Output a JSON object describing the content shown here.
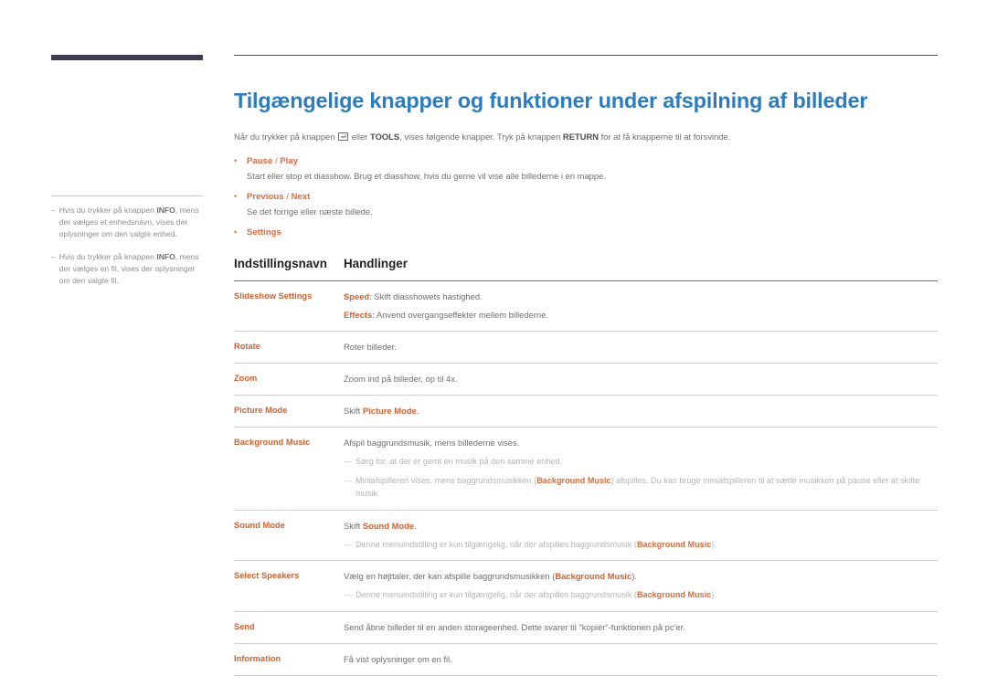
{
  "sidebar": {
    "notes": [
      {
        "marker": "–",
        "segments": [
          {
            "t": "Hvis du trykker på knappen ",
            "b": false
          },
          {
            "t": "INFO",
            "b": true
          },
          {
            "t": ", mens der vælges et enhedsnavn, vises der oplysninger om den valgte enhed.",
            "b": false
          }
        ]
      },
      {
        "marker": "–",
        "segments": [
          {
            "t": "Hvis du trykker på knappen ",
            "b": false
          },
          {
            "t": "INFO",
            "b": true
          },
          {
            "t": ", mens der vælges en fil, vises der oplysninger om den valgte fil.",
            "b": false
          }
        ]
      }
    ]
  },
  "main": {
    "title": "Tilgængelige knapper og funktioner under afspilning af billeder",
    "intro": {
      "part1": "Når du trykker på knappen ",
      "key_icon": "enter-key-icon",
      "part2": " eller ",
      "tools": "TOOLS",
      "part3": ", vises følgende knapper. Tryk på knappen ",
      "return": "RETURN",
      "part4": " for at få knapperne til at forsvinde."
    },
    "bullets": [
      {
        "marker": "•",
        "head_a": "Pause",
        "sep": " / ",
        "head_b": "Play",
        "desc": "Start eller stop et diasshow. Brug et diasshow, hvis du gerne vil vise alle billederne i en mappe."
      },
      {
        "marker": "•",
        "head_a": "Previous",
        "sep": " / ",
        "head_b": "Next",
        "desc": "Se det forrige eller næste billede."
      },
      {
        "marker": "•",
        "head_a": "Settings",
        "sep": "",
        "head_b": "",
        "desc": ""
      }
    ],
    "table": {
      "headers": [
        "Indstillingsnavn",
        "Handlinger"
      ],
      "rows": [
        {
          "name": "Slideshow Settings",
          "lines": [
            [
              {
                "t": "Speed",
                "k": true
              },
              {
                "t": ": Skift diasshowets hastighed.",
                "k": false
              }
            ],
            [
              {
                "t": "Effects",
                "k": true
              },
              {
                "t": ": Anvend overgangseffekter mellem billederne.",
                "k": false
              }
            ]
          ],
          "notes": []
        },
        {
          "name": "Rotate",
          "lines": [
            [
              {
                "t": "Roter billeder.",
                "k": false
              }
            ]
          ],
          "notes": []
        },
        {
          "name": "Zoom",
          "lines": [
            [
              {
                "t": "Zoom ind på billeder, op til 4x.",
                "k": false
              }
            ]
          ],
          "notes": []
        },
        {
          "name": "Picture Mode",
          "lines": [
            [
              {
                "t": "Skift ",
                "k": false
              },
              {
                "t": "Picture Mode",
                "k": true
              },
              {
                "t": ".",
                "k": false
              }
            ]
          ],
          "notes": []
        },
        {
          "name": "Background Music",
          "lines": [
            [
              {
                "t": "Afspil baggrundsmusik, mens billederne vises.",
                "k": false
              }
            ]
          ],
          "notes": [
            {
              "marker": "—",
              "segments": [
                {
                  "t": "Sørg for, at der er gemt en musik på den samme enhed.",
                  "k": false
                }
              ]
            },
            {
              "marker": "—",
              "segments": [
                {
                  "t": "Miniafspilleren vises, mens baggrundsmusikken (",
                  "k": false
                },
                {
                  "t": "Background Music",
                  "k": true
                },
                {
                  "t": ") afspilles. Du kan bruge miniafspilleren til at sætte musikken på pause eller at skifte musik.",
                  "k": false
                }
              ]
            }
          ]
        },
        {
          "name": "Sound Mode",
          "lines": [
            [
              {
                "t": "Skift ",
                "k": false
              },
              {
                "t": "Sound Mode",
                "k": true
              },
              {
                "t": ".",
                "k": false
              }
            ]
          ],
          "notes": [
            {
              "marker": "—",
              "segments": [
                {
                  "t": "Denne menuindstilling er kun tilgængelig, når der afspilles baggrundsmusik (",
                  "k": false
                },
                {
                  "t": "Background Music",
                  "k": true
                },
                {
                  "t": ").",
                  "k": false
                }
              ]
            }
          ]
        },
        {
          "name": "Select Speakers",
          "lines": [
            [
              {
                "t": "Vælg en højttaler, der kan afspille baggrundsmusikken (",
                "k": false
              },
              {
                "t": "Background Music",
                "k": true
              },
              {
                "t": ").",
                "k": false
              }
            ]
          ],
          "notes": [
            {
              "marker": "—",
              "segments": [
                {
                  "t": "Denne menuindstilling er kun tilgængelig, når der afspilles baggrundsmusik (",
                  "k": false
                },
                {
                  "t": "Background Music",
                  "k": true
                },
                {
                  "t": ").",
                  "k": false
                }
              ]
            }
          ]
        },
        {
          "name": "Send",
          "lines": [
            [
              {
                "t": "Send åbne billeder til en anden storageenhed. Dette svarer til \"kopiér\"-funktionen på pc'er.",
                "k": false
              }
            ]
          ],
          "notes": []
        },
        {
          "name": "Information",
          "lines": [
            [
              {
                "t": "Få vist oplysninger om en fil.",
                "k": false
              }
            ]
          ],
          "notes": []
        }
      ]
    }
  },
  "colors": {
    "title_blue": "#2b7cc0",
    "accent_orange": "#d95f2b",
    "bullet_orange": "#e4673c",
    "sidebar_bar": "#403a53",
    "body_gray": "#6d6e70",
    "note_gray": "#b4b4b6"
  }
}
